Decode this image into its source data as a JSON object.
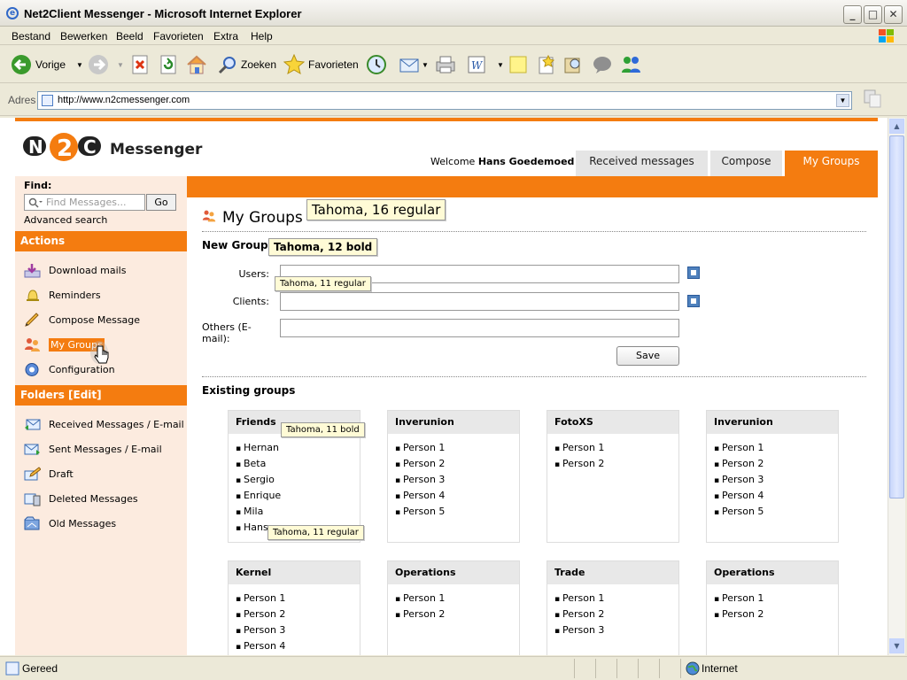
{
  "window": {
    "title": "Net2Client Messenger - Microsoft Internet Explorer"
  },
  "menu": [
    "Bestand",
    "Bewerken",
    "Beeld",
    "Favorieten",
    "Extra",
    "Help"
  ],
  "toolbar": {
    "back_label": "Vorige",
    "search_label": "Zoeken",
    "favorites_label": "Favorieten"
  },
  "address": {
    "label": "Adres",
    "url": "http://www.n2cmessenger.com"
  },
  "logo": {
    "mark": "N2C",
    "brand": "Messenger"
  },
  "header": {
    "welcome_prefix": "Welcome",
    "user_name": "Hans Goedemoed"
  },
  "tabs": [
    {
      "label": "Received messages",
      "active": false
    },
    {
      "label": "Compose",
      "active": false
    },
    {
      "label": "My Groups",
      "active": true
    }
  ],
  "sidebar": {
    "find_label": "Find:",
    "search_placeholder": "Find Messages...",
    "go_label": "Go",
    "advanced_label": "Advanced search",
    "actions_title": "Actions",
    "actions": [
      {
        "label": "Download mails",
        "icon": "download-icon"
      },
      {
        "label": "Reminders",
        "icon": "bell-icon"
      },
      {
        "label": "Compose Message",
        "icon": "pencil-icon"
      },
      {
        "label": "My Groups",
        "icon": "group-icon",
        "highlighted": true
      },
      {
        "label": "Configuration",
        "icon": "gear-icon"
      }
    ],
    "folders_title": "Folders [Edit]",
    "folders": [
      {
        "label": "Received Messages / E-mail",
        "icon": "inbox-icon"
      },
      {
        "label": "Sent Messages / E-mail",
        "icon": "sent-icon"
      },
      {
        "label": "Draft",
        "icon": "draft-icon"
      },
      {
        "label": "Deleted Messages",
        "icon": "trash-icon"
      },
      {
        "label": "Old Messages",
        "icon": "archive-icon"
      }
    ]
  },
  "main": {
    "title": "My Groups",
    "new_group_title": "New Group",
    "fields": {
      "users_label": "Users:",
      "clients_label": "Clients:",
      "others_label": "Others (E-mail):"
    },
    "save_label": "Save",
    "existing_title": "Existing groups",
    "groups": [
      {
        "name": "Friends",
        "members": [
          "Hernan",
          "Beta",
          "Sergio",
          "Enrique",
          "Mila",
          "Hans"
        ]
      },
      {
        "name": "Inverunion",
        "members": [
          "Person 1",
          "Person 2",
          "Person 3",
          "Person 4",
          "Person 5"
        ]
      },
      {
        "name": "FotoXS",
        "members": [
          "Person 1",
          "Person 2"
        ]
      },
      {
        "name": "Inverunion",
        "members": [
          "Person 1",
          "Person 2",
          "Person 3",
          "Person 4",
          "Person 5"
        ]
      },
      {
        "name": "Kernel",
        "members": [
          "Person 1",
          "Person 2",
          "Person 3",
          "Person 4"
        ]
      },
      {
        "name": "Operations",
        "members": [
          "Person 1",
          "Person 2"
        ]
      },
      {
        "name": "Trade",
        "members": [
          "Person 1",
          "Person 2",
          "Person 3"
        ]
      },
      {
        "name": "Operations",
        "members": [
          "Person 1",
          "Person 2"
        ]
      }
    ]
  },
  "annotations": {
    "title_font": "Tahoma, 16 regular",
    "subtitle_font": "Tahoma, 12 bold",
    "label_font": "Tahoma, 11 regular",
    "group_header_font": "Tahoma, 11 bold",
    "member_font": "Tahoma, 11 regular"
  },
  "status": {
    "left": "Gereed",
    "zone": "Internet"
  },
  "colors": {
    "accent": "#f47c10",
    "sidebar_bg": "#fcebdf"
  }
}
